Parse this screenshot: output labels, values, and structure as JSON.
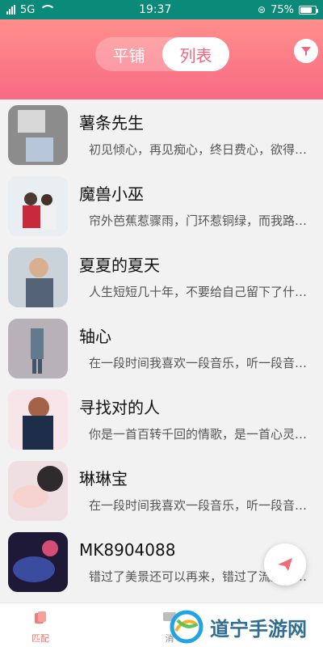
{
  "status": {
    "network": "5G",
    "time": "19:37",
    "battery": "75%"
  },
  "header": {
    "tab_tile": "平铺",
    "tab_list": "列表",
    "accent": "#f76a84"
  },
  "users": [
    {
      "name": "薯条先生",
      "sig": "初见倾心，再见痴心，终日费心，欲得芳..."
    },
    {
      "name": "魔兽小巫",
      "sig": "帘外芭蕉惹骤雨，门环惹铜绿，而我路过..."
    },
    {
      "name": "夏夏的夏天",
      "sig": "人生短短几十年，不要给自己留下了什么..."
    },
    {
      "name": "轴心",
      "sig": "在一段时间我喜欢一段音乐，听一段音乐..."
    },
    {
      "name": "寻找对的人",
      "sig": "你是一首百转千回的情歌，是一首心灵的..."
    },
    {
      "name": "琳琳宝",
      "sig": "在一段时间我喜欢一段音乐，听一段音乐..."
    },
    {
      "name": "MK8904088",
      "sig": "错过了美景还可以再来，错过了流星还可..."
    }
  ],
  "bottom_nav": {
    "match": "匹配",
    "message": "消"
  },
  "watermark": {
    "text": "道宁手游网"
  }
}
